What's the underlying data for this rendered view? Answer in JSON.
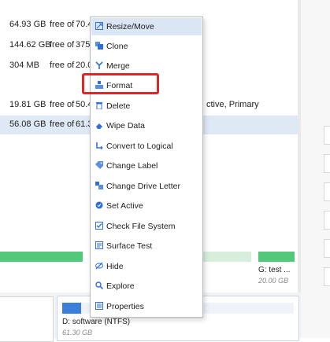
{
  "partitions": [
    {
      "size": "64.93 GB",
      "free_of": "free of",
      "rest": "70.4",
      "status": ""
    },
    {
      "size": "144.62 GB",
      "free_of": "free of",
      "rest": "375",
      "status": ""
    },
    {
      "size": "304 MB",
      "free_of": "free of",
      "rest": "20.0",
      "status": ""
    },
    {
      "size": "19.81 GB",
      "free_of": "free of",
      "rest": "50.4",
      "status": "ctive, Primary"
    },
    {
      "size": "56.08 GB",
      "free_of": "free of",
      "rest": "61.3",
      "status": ""
    }
  ],
  "map": {
    "g_label": "G: test ...",
    "g_size": "20.00 GB",
    "d_label": "D: software (NTFS)",
    "d_size": "61.30 GB"
  },
  "context_menu": {
    "items": [
      {
        "label": "Resize/Move",
        "icon": "resize-icon"
      },
      {
        "label": "Clone",
        "icon": "clone-icon"
      },
      {
        "label": "Merge",
        "icon": "merge-icon"
      },
      {
        "label": "Format",
        "icon": "format-icon"
      },
      {
        "label": "Delete",
        "icon": "delete-icon"
      },
      {
        "label": "Wipe Data",
        "icon": "wipe-icon"
      },
      {
        "label": "Convert to Logical",
        "icon": "convert-icon"
      },
      {
        "label": "Change Label",
        "icon": "label-icon"
      },
      {
        "label": "Change Drive Letter",
        "icon": "drive-letter-icon"
      },
      {
        "label": "Set Active",
        "icon": "set-active-icon"
      },
      {
        "label": "Check File System",
        "icon": "check-icon"
      },
      {
        "label": "Surface Test",
        "icon": "surface-test-icon"
      },
      {
        "label": "Hide",
        "icon": "hide-icon"
      },
      {
        "label": "Explore",
        "icon": "explore-icon"
      },
      {
        "label": "Properties",
        "icon": "properties-icon"
      }
    ],
    "highlighted": "Resize/Move",
    "callout_target": "Format"
  },
  "colors": {
    "accent": "#3b7fdb",
    "selection": "#dfe8f5",
    "callout": "#e02626",
    "used_bar": "#52c97a"
  }
}
